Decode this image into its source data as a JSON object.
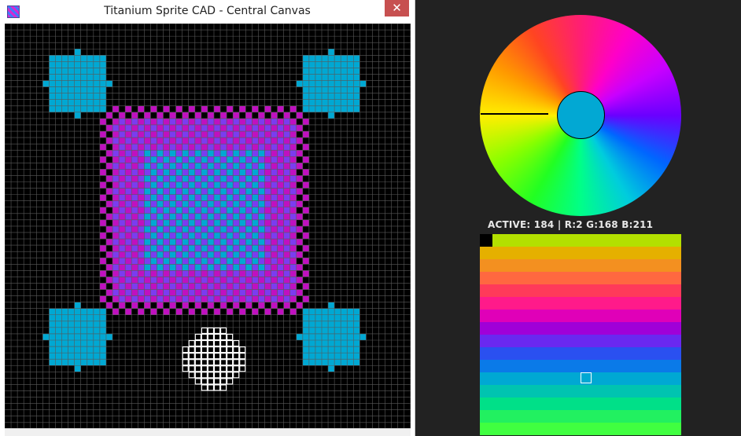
{
  "window": {
    "title": "Titanium Sprite CAD - Central Canvas",
    "close_glyph": "✕",
    "icon": "app-sprite-icon"
  },
  "canvas": {
    "background": "#000000",
    "grid_line_color": "#5a5a5a",
    "colors": {
      "cyan": "#00a8d3",
      "magenta": "#c010c0",
      "blue_violet": "#7b3cf0",
      "white_cursor": "#ffffff"
    }
  },
  "color_wheel": {
    "active_color": "#02a8d3"
  },
  "readout": {
    "text": "ACTIVE: 184 | R:2 G:168 B:211"
  },
  "palette": {
    "rows": [
      "#b3e000",
      "#e5b000",
      "#f39020",
      "#ff6840",
      "#ff3a5a",
      "#ff1a8a",
      "#e000b8",
      "#a000d8",
      "#6a28f0",
      "#2a50f0",
      "#0a7ae8",
      "#00a8d3",
      "#00c4b0",
      "#00e088",
      "#22f060",
      "#40ff40"
    ],
    "selected_marker": "palette-selected-swatch"
  }
}
